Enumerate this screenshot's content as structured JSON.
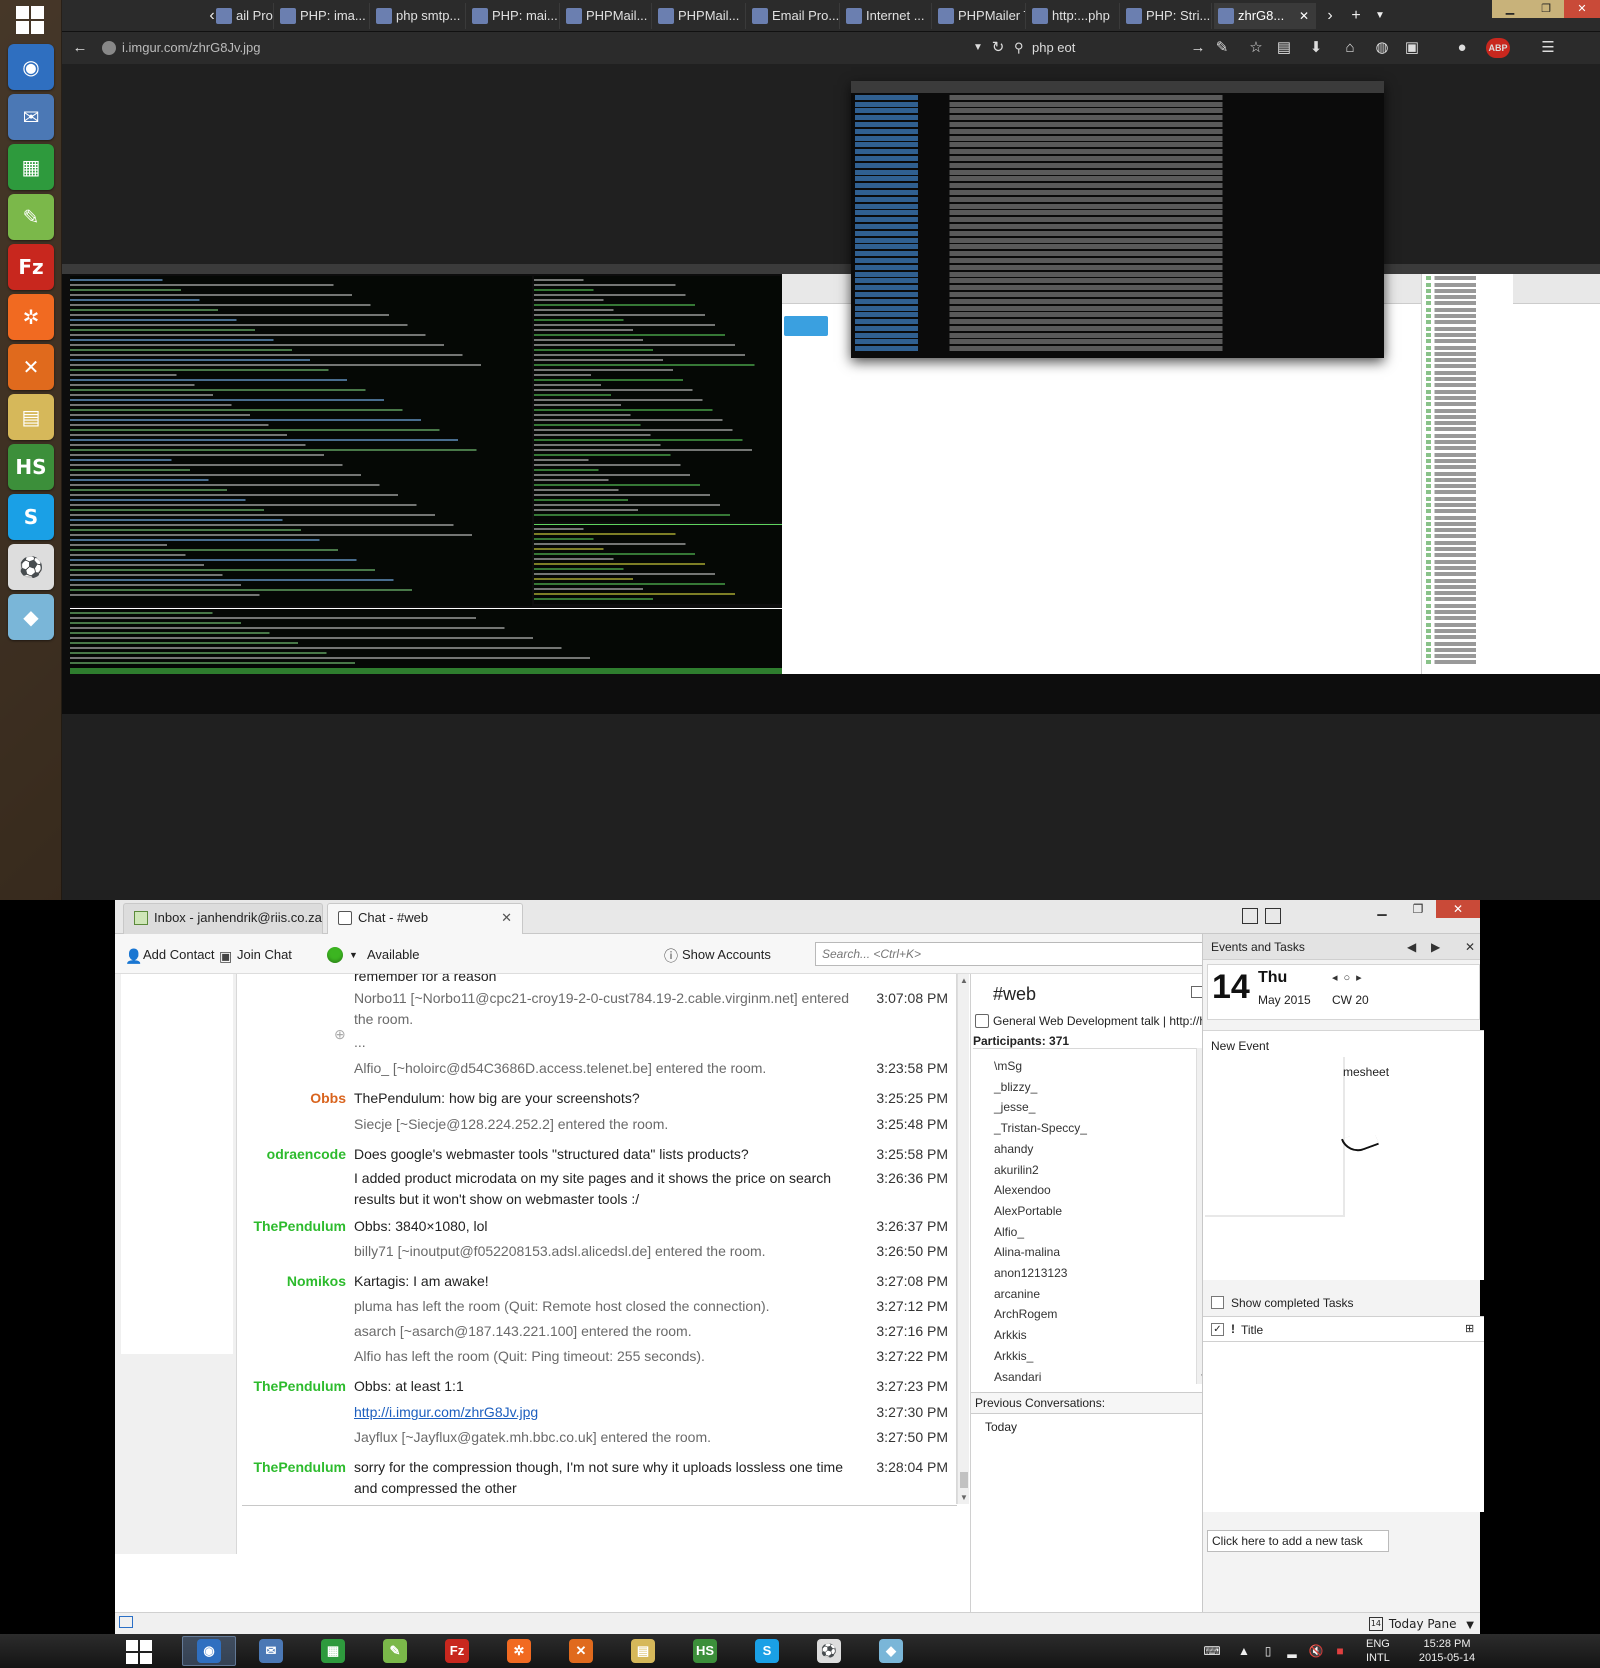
{
  "top": {
    "browser_tabs": [
      {
        "label": "ail Pro..."
      },
      {
        "label": "PHP: ima..."
      },
      {
        "label": "php smtp..."
      },
      {
        "label": "PHP: mai..."
      },
      {
        "label": "PHPMail..."
      },
      {
        "label": "PHPMail..."
      },
      {
        "label": "Email Pro..."
      },
      {
        "label": "Internet ..."
      },
      {
        "label": "PHPMailer Te..."
      },
      {
        "label": "http:...php"
      },
      {
        "label": "PHP: Stri..."
      },
      {
        "label": "zhrG8..."
      }
    ],
    "url": "i.imgur.com/zhrG8Jv.jpg",
    "search_value": "php eot",
    "icons": {
      "back": "back-arrow-icon",
      "reload": "reload-icon",
      "bookmark": "star-icon",
      "download": "download-icon",
      "home": "home-icon",
      "menu": "hamburger-menu-icon"
    },
    "launcher": [
      {
        "name": "firefox",
        "color": "#2f6fc0",
        "glyph": "◉"
      },
      {
        "name": "thunderbird",
        "color": "#4b78b5",
        "glyph": "✉"
      },
      {
        "name": "spreadsheet",
        "color": "#2e9a3d",
        "glyph": "▦"
      },
      {
        "name": "editor",
        "color": "#7bb84a",
        "glyph": "✎"
      },
      {
        "name": "filezilla",
        "color": "#c8271e",
        "glyph": "Fz"
      },
      {
        "name": "xampp",
        "color": "#f16a21",
        "glyph": "✲"
      },
      {
        "name": "app-x",
        "color": "#e06a1d",
        "glyph": "✕"
      },
      {
        "name": "file-manager",
        "color": "#d6b85a",
        "glyph": "▤"
      },
      {
        "name": "hs",
        "color": "#3c8f3a",
        "glyph": "HS"
      },
      {
        "name": "skype",
        "color": "#1aa0e6",
        "glyph": "S"
      },
      {
        "name": "ball",
        "color": "#dddddd",
        "glyph": "⚽"
      },
      {
        "name": "notes",
        "color": "#7ab6d8",
        "glyph": "◆"
      }
    ]
  },
  "thunderbird": {
    "tabs": [
      {
        "label": "Inbox - janhendrik@riis.co.za"
      },
      {
        "label": "Chat - #web"
      }
    ],
    "toolbar": {
      "add_contact": "Add Contact",
      "join_chat": "Join Chat",
      "status": "Available",
      "show_accounts": "Show Accounts",
      "search_placeholder": "Search... <Ctrl+K>"
    },
    "messages": [
      {
        "nick": "",
        "text": "remember for a reason",
        "time": "",
        "sys": false
      },
      {
        "nick": "",
        "text": "Norbo11 [~Norbo11@cpc21-croy19-2-0-cust784.19-2.cable.virginm.net] entered the room.",
        "time": "3:07:08 PM",
        "sys": true
      },
      {
        "nick": "",
        "text": "...",
        "time": "",
        "sys": true
      },
      {
        "nick": "",
        "text": "Alfio_ [~holoirc@d54C3686D.access.telenet.be] entered the room.",
        "time": "3:23:58 PM",
        "sys": true
      },
      {
        "nick": "Obbs",
        "text": "ThePendulum: how big are your screenshots?",
        "time": "3:25:25 PM",
        "sys": false,
        "color": "orange"
      },
      {
        "nick": "",
        "text": "Siecje [~Siecje@128.224.252.2] entered the room.",
        "time": "3:25:48 PM",
        "sys": true
      },
      {
        "nick": "odraencode",
        "text": "Does google's webmaster tools \"structured data\" lists products?",
        "time": "3:25:58 PM",
        "sys": false,
        "color": "green"
      },
      {
        "nick": "",
        "text": "I added product microdata on my site pages and it shows the price on search results but it won't show on webmaster tools :/",
        "time": "3:26:36 PM",
        "sys": false
      },
      {
        "nick": "ThePendulum",
        "text": "Obbs: 3840×1080, lol",
        "time": "3:26:37 PM",
        "sys": false,
        "color": "green"
      },
      {
        "nick": "",
        "text": "billy71 [~inoutput@f052208153.adsl.alicedsl.de] entered the room.",
        "time": "3:26:50 PM",
        "sys": true
      },
      {
        "nick": "Nomikos",
        "text": "Kartagis: I am awake!",
        "time": "3:27:08 PM",
        "sys": false,
        "color": "green"
      },
      {
        "nick": "",
        "text": "pluma has left the room (Quit: Remote host closed the connection).",
        "time": "3:27:12 PM",
        "sys": true
      },
      {
        "nick": "",
        "text": "asarch [~asarch@187.143.221.100] entered the room.",
        "time": "3:27:16 PM",
        "sys": true
      },
      {
        "nick": "",
        "text": "Alfio has left the room (Quit: Ping timeout: 255 seconds).",
        "time": "3:27:22 PM",
        "sys": true
      },
      {
        "nick": "ThePendulum",
        "text": "Obbs: at least 1:1",
        "time": "3:27:23 PM",
        "sys": false,
        "color": "green"
      },
      {
        "nick": "",
        "text": "http://i.imgur.com/zhrG8Jv.jpg",
        "time": "3:27:30 PM",
        "sys": false,
        "link": true
      },
      {
        "nick": "",
        "text": "Jayflux [~Jayflux@gatek.mh.bbc.co.uk] entered the room.",
        "time": "3:27:50 PM",
        "sys": true
      },
      {
        "nick": "ThePendulum",
        "text": "sorry for the compression though, I'm not sure why it uploads lossless one time and compressed the other",
        "time": "3:28:04 PM",
        "sys": false,
        "color": "green"
      }
    ],
    "channel": {
      "name": "#web",
      "topic": "General Web Development talk | http://ha...",
      "participants_label": "Participants:",
      "participants_count": "371",
      "participants": [
        "\\mSg",
        "_blizzy_",
        "_jesse_",
        "_Tristan-Speccy_",
        "ahandy",
        "akurilin2",
        "Alexendoo",
        "AlexPortable",
        "Alfio_",
        "Alina-malina",
        "anon1213123",
        "arcanine",
        "ArchRogem",
        "Arkkis",
        "Arkkis_",
        "Asandari"
      ],
      "previous_label": "Previous Conversations:",
      "previous_today": "Today"
    },
    "today_pane": {
      "header": "Events and Tasks",
      "day_number": "14",
      "day_name": "Thu",
      "month_year": "May 2015",
      "calendar_week": "CW 20",
      "new_event": "New Event",
      "partial_text": "mesheet",
      "show_completed": "Show completed Tasks",
      "title_col": "Title",
      "new_task": "Click here to add a new task",
      "today_pane_button": "Today Pane"
    }
  },
  "taskbar": {
    "apps": [
      {
        "name": "firefox",
        "color": "#2f6fc0",
        "glyph": "◉",
        "active": true
      },
      {
        "name": "thunderbird",
        "color": "#4b78b5",
        "glyph": "✉",
        "active": false
      },
      {
        "name": "spreadsheet",
        "color": "#2e9a3d",
        "glyph": "▦",
        "active": false
      },
      {
        "name": "editor",
        "color": "#7bb84a",
        "glyph": "✎",
        "active": false
      },
      {
        "name": "filezilla",
        "color": "#c8271e",
        "glyph": "Fz",
        "active": false
      },
      {
        "name": "xampp",
        "color": "#f16a21",
        "glyph": "✲",
        "active": false
      },
      {
        "name": "app-x",
        "color": "#e06a1d",
        "glyph": "✕",
        "active": false
      },
      {
        "name": "file-manager",
        "color": "#d6b85a",
        "glyph": "▤",
        "active": false
      },
      {
        "name": "hs",
        "color": "#3c8f3a",
        "glyph": "HS",
        "active": false
      },
      {
        "name": "skype",
        "color": "#1aa0e6",
        "glyph": "S",
        "active": false
      },
      {
        "name": "ball",
        "color": "#dddddd",
        "glyph": "⚽",
        "active": false
      },
      {
        "name": "notes",
        "color": "#7ab6d8",
        "glyph": "◆",
        "active": false
      }
    ],
    "lang_top": "ENG",
    "lang_bottom": "INTL",
    "time": "15:28 PM",
    "date": "2015-05-14"
  }
}
